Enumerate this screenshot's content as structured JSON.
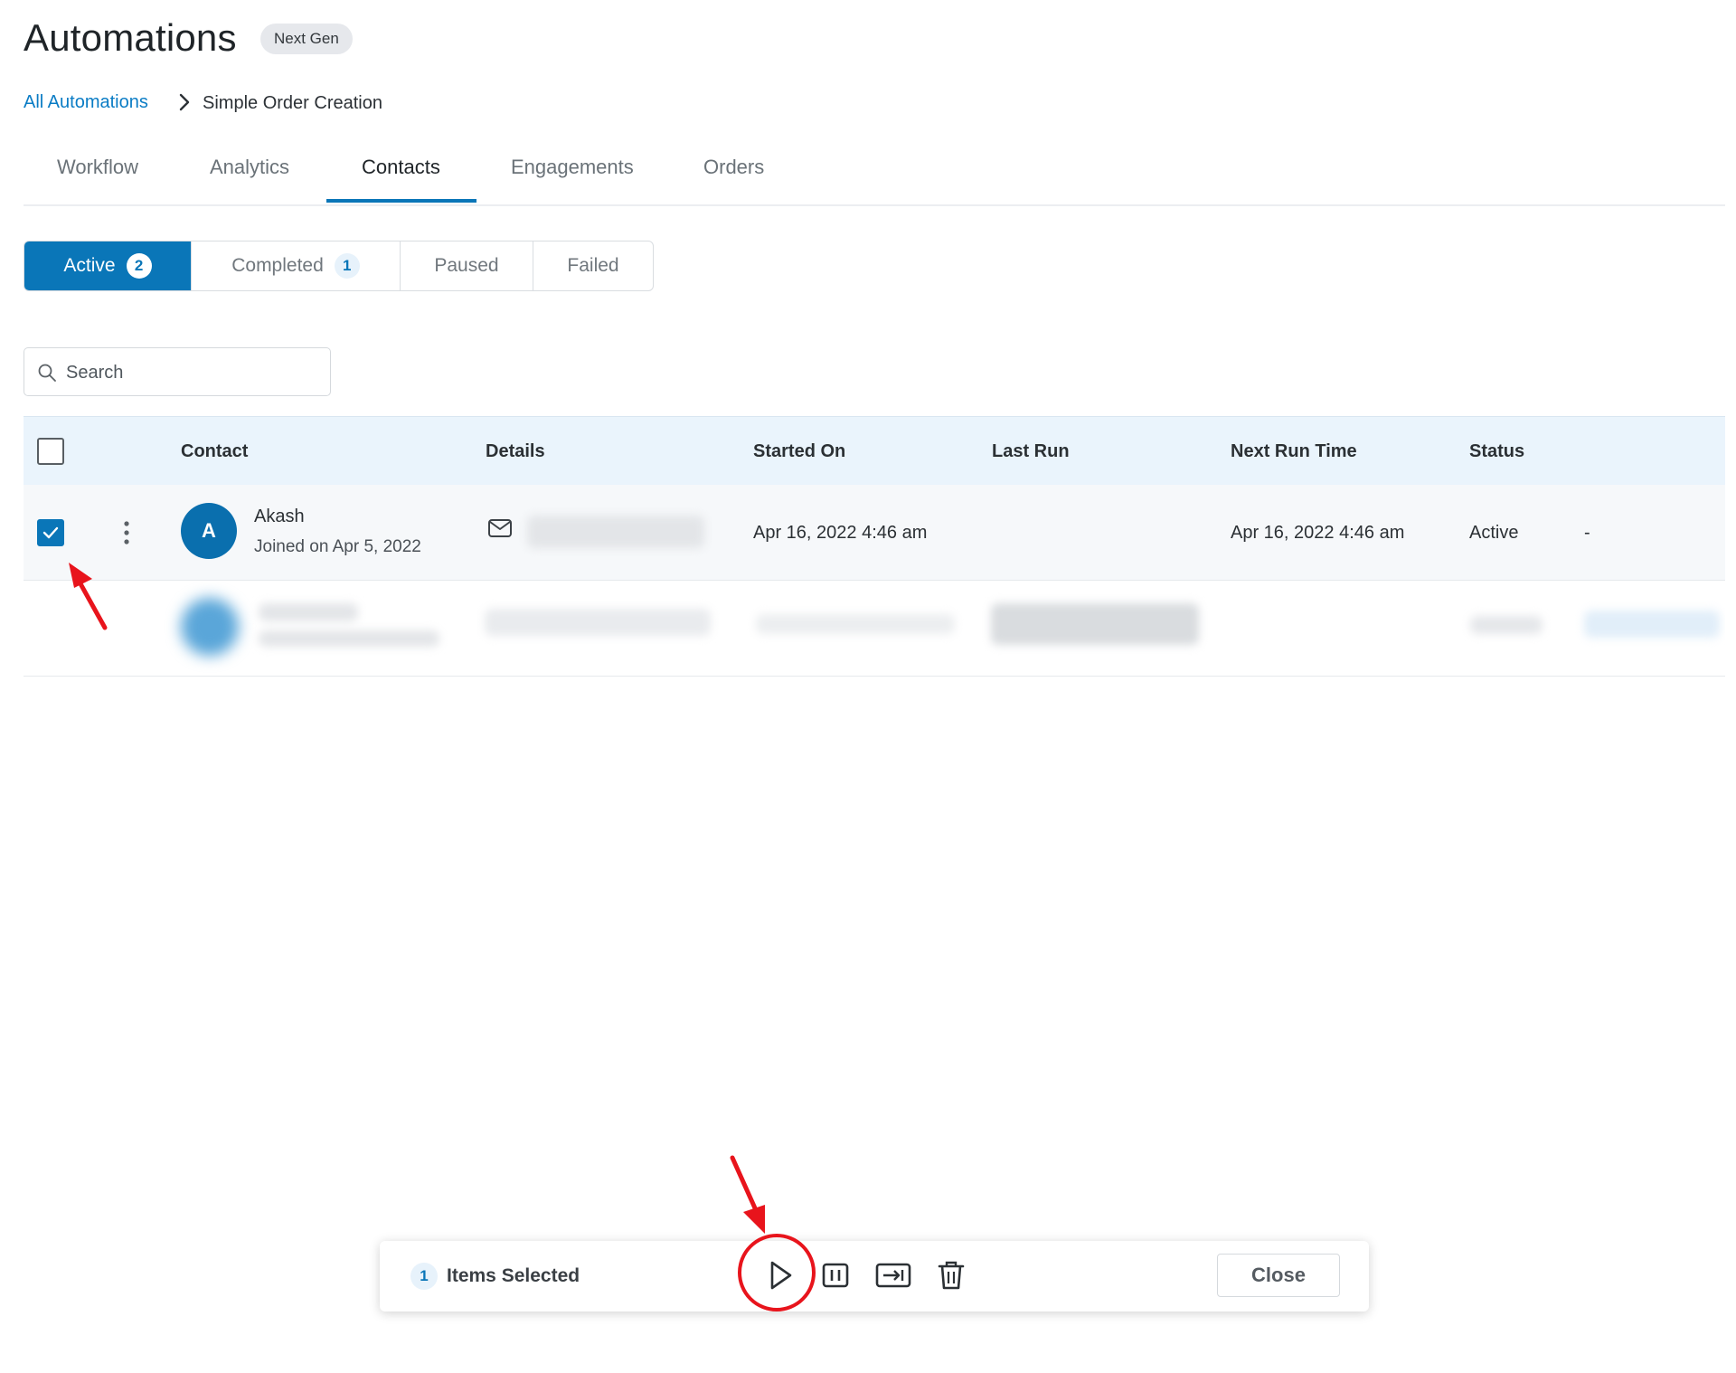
{
  "header": {
    "title": "Automations",
    "badge": "Next Gen"
  },
  "breadcrumb": {
    "root": "All Automations",
    "current": "Simple Order Creation"
  },
  "tabs": [
    {
      "label": "Workflow"
    },
    {
      "label": "Analytics"
    },
    {
      "label": "Contacts",
      "active": true
    },
    {
      "label": "Engagements"
    },
    {
      "label": "Orders"
    }
  ],
  "filters": [
    {
      "label": "Active",
      "count": "2",
      "active": true
    },
    {
      "label": "Completed",
      "count": "1"
    },
    {
      "label": "Paused"
    },
    {
      "label": "Failed"
    }
  ],
  "search": {
    "placeholder": "Search"
  },
  "table": {
    "columns": [
      "Contact",
      "Details",
      "Started On",
      "Last Run",
      "Next Run Time",
      "Status"
    ],
    "rows": [
      {
        "initial": "A",
        "name": "Akash",
        "joined": "Joined on Apr 5, 2022",
        "started_on": "Apr 16, 2022 4:46 am",
        "last_run": "",
        "next_run_time": "Apr 16, 2022 4:46 am",
        "status": "Active",
        "extra": "-",
        "checked": true
      }
    ]
  },
  "bulk_bar": {
    "count": "1",
    "label": "Items Selected",
    "close_label": "Close"
  },
  "icons": {
    "breadcrumb_separator": "chevron-right-icon",
    "search": "search-icon",
    "row_menu": "kebab-menu-icon",
    "details": "mail-icon",
    "bulk_actions": [
      "play-icon",
      "pause-icon",
      "move-to-icon",
      "trash-icon"
    ]
  },
  "colors": {
    "primary": "#0a76b8",
    "link": "#0a7cc5",
    "header_row_bg": "#eaf4fc",
    "annotation": "#e8141c"
  }
}
